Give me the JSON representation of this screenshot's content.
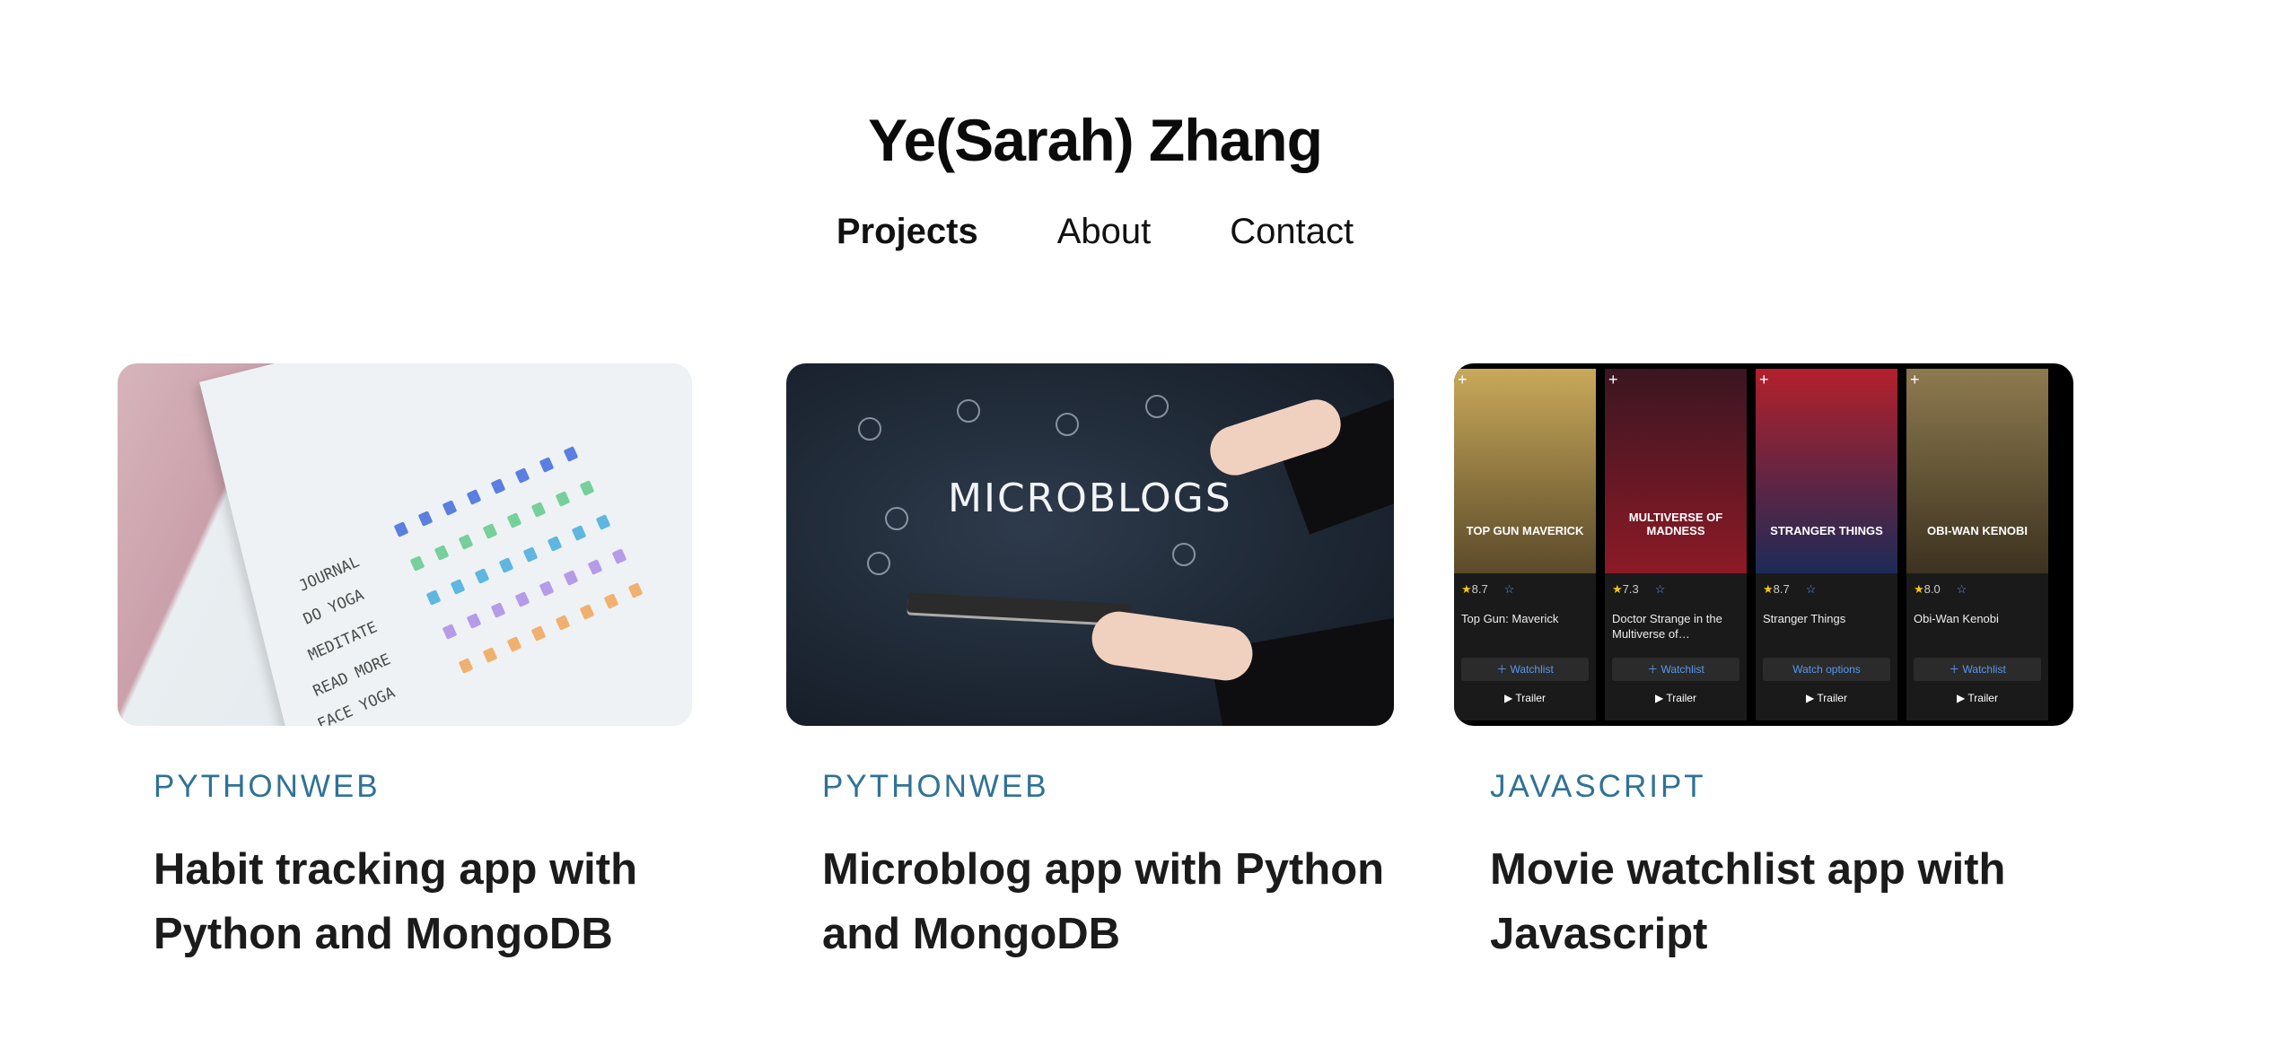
{
  "site": {
    "title": "Ye(Sarah) Zhang"
  },
  "nav": {
    "items": [
      {
        "label": "Projects",
        "active": true
      },
      {
        "label": "About",
        "active": false
      },
      {
        "label": "Contact",
        "active": false
      }
    ]
  },
  "projects": [
    {
      "category": "PYTHONWEB",
      "title": "Habit tracking app with Python and MongoDB",
      "thumb": {
        "rows": [
          "JOURNAL",
          "DO YOGA",
          "MEDITATE",
          "READ MORE",
          "FACE YOGA"
        ]
      }
    },
    {
      "category": "PYTHONWEB",
      "title": "Microblog app with Python and MongoDB",
      "thumb": {
        "headline": "MICROBLOGS"
      }
    },
    {
      "category": "JAVASCRIPT",
      "title": "Movie watchlist app with Javascript",
      "thumb": {
        "movies": [
          {
            "rating": "8.7",
            "title": "Top Gun: Maverick",
            "art_text": "TOP GUN MAVERICK",
            "button": "Watchlist",
            "trailer": "Trailer",
            "color": "#b08a3c"
          },
          {
            "rating": "7.3",
            "title": "Doctor Strange in the Multiverse of…",
            "art_text": "MULTIVERSE OF MADNESS",
            "button": "Watchlist",
            "trailer": "Trailer",
            "color": "#7a1620"
          },
          {
            "rating": "8.7",
            "title": "Stranger Things",
            "art_text": "STRANGER THINGS",
            "button": "Watch options",
            "trailer": "Trailer",
            "color": "#1f2e63"
          },
          {
            "rating": "8.0",
            "title": "Obi-Wan Kenobi",
            "art_text": "OBI-WAN KENOBI",
            "button": "Watchlist",
            "trailer": "Trailer",
            "color": "#6f5a33"
          }
        ]
      }
    }
  ]
}
